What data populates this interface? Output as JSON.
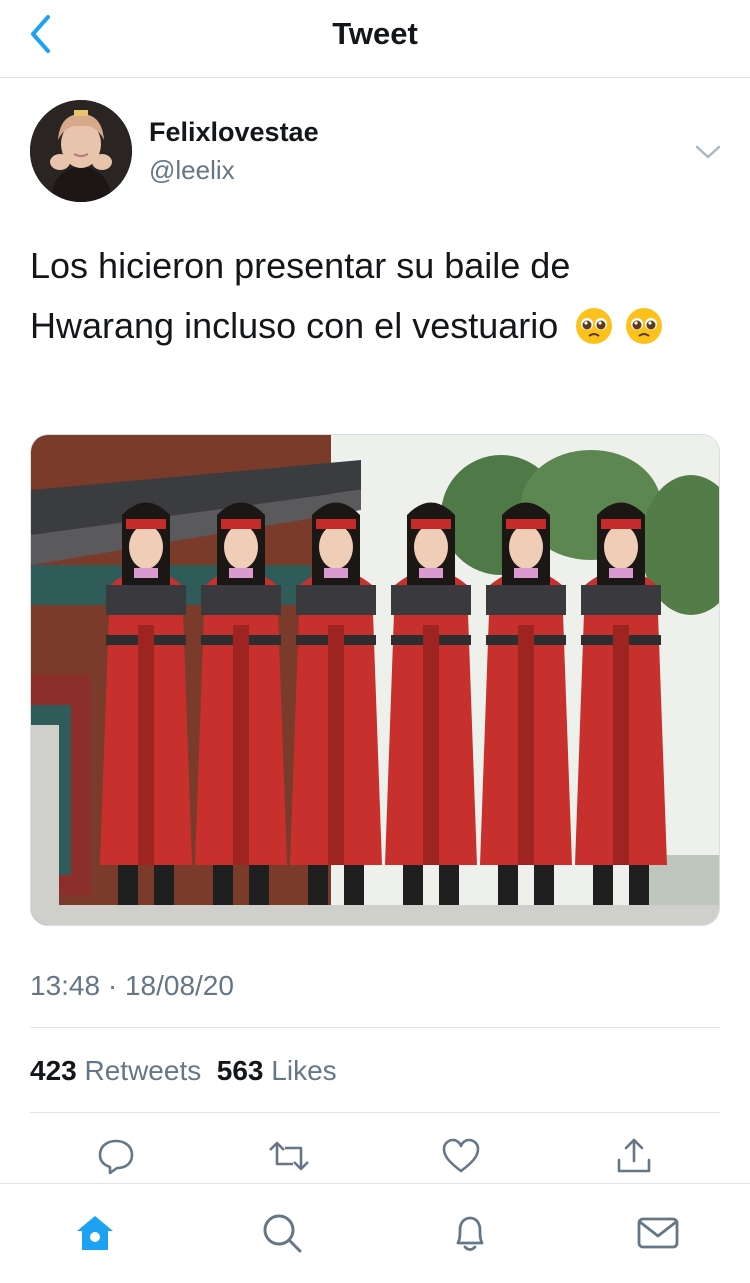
{
  "header": {
    "title": "Tweet"
  },
  "author": {
    "name": "Felixlovestae",
    "handle": "@leelix"
  },
  "tweet": {
    "text": "Los hicieron presentar su baile de Hwarang incluso con el vestuario",
    "timestamp": "13:48 · 18/08/20"
  },
  "stats": {
    "retweets_count": "423",
    "retweets_label": "Retweets",
    "likes_count": "563",
    "likes_label": "Likes"
  },
  "icons": {
    "back": "chevron-left-icon",
    "caret": "chevron-down-icon",
    "reply": "reply-icon",
    "retweet": "retweet-icon",
    "like": "heart-icon",
    "share": "share-icon",
    "home": "home-icon",
    "search": "search-icon",
    "notifications": "bell-icon",
    "messages": "mail-icon"
  },
  "colors": {
    "accent": "#1da1f2",
    "text": "#14171a",
    "secondary": "#657786",
    "divider": "#dfe3e7"
  }
}
